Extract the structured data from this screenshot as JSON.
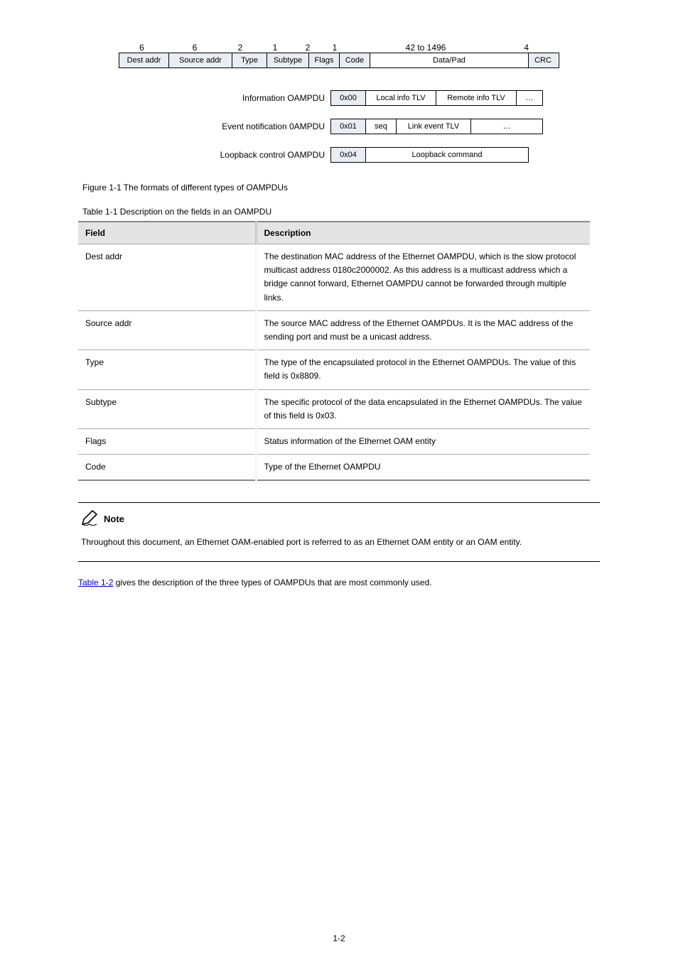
{
  "frame_header_bytes": {
    "dest": "6",
    "src": "6",
    "type": "2",
    "subtype": "1",
    "flags": "2",
    "code": "1",
    "data": "42 to 1496",
    "crc": "4"
  },
  "frame_fields": {
    "dest": "Dest addr",
    "src": "Source addr",
    "type": "Type",
    "subtype": "Subtype",
    "flags": "Flags",
    "code": "Code",
    "data": "Data/Pad",
    "crc": "CRC"
  },
  "sub_rows": {
    "info": {
      "label": "Information OAMPDU",
      "code": "0x00",
      "c1": "Local info TLV",
      "c2": "Remote info TLV",
      "dots": "…"
    },
    "event": {
      "label": "Event notification 0AMPDU",
      "code": "0x01",
      "seq": "seq",
      "c1": "Link event TLV",
      "dots": "…"
    },
    "loop": {
      "label": "Loopback control OAMPDU",
      "code": "0x04",
      "c1": "Loopback command"
    }
  },
  "captions": {
    "figure": "Figure 1-1 The formats of different types of OAMPDUs",
    "table": "Table 1-1 Description on the fields in an OAMPDU"
  },
  "table_header": {
    "c1": "Field",
    "c2": "Description"
  },
  "table_rows": [
    {
      "f": "Dest addr",
      "d": "The destination MAC address of the Ethernet OAMPDU, which is the slow protocol multicast address 0180c2000002. As this address is a multicast address which a bridge cannot forward, Ethernet OAMPDU cannot be forwarded through multiple links."
    },
    {
      "f": "Source addr",
      "d": "The source MAC address of the Ethernet OAMPDUs. It is the MAC address of the sending port and must be a unicast address."
    },
    {
      "f": "Type",
      "d": "The type of the encapsulated protocol in the Ethernet OAMPDUs. The value of this field is 0x8809."
    },
    {
      "f": "Subtype",
      "d": "The specific protocol of the data encapsulated in the Ethernet OAMPDUs. The value of this field is 0x03."
    },
    {
      "f": "Flags",
      "d": "Status information of the Ethernet OAM entity"
    },
    {
      "f": "Code",
      "d": "Type of the Ethernet OAMPDU"
    }
  ],
  "note": {
    "title": "Note",
    "body": "Throughout this document, an Ethernet OAM-enabled port is referred to as an Ethernet OAM entity or an OAM entity."
  },
  "para": {
    "text_a": " gives the description of the three types of OAMPDUs that are most commonly used.",
    "table_ref": "Table 1-2"
  },
  "page_number": "1-2"
}
